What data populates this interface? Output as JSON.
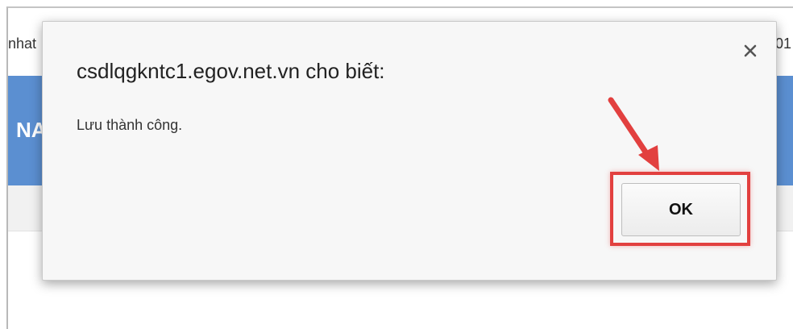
{
  "background": {
    "left_text": "nhat",
    "right_text": "01",
    "blue_bar_text": "NA",
    "blue_color": "#5b8fd1"
  },
  "dialog": {
    "title": "csdlqgkntc1.egov.net.vn cho biết:",
    "message": "Lưu thành công.",
    "close_label": "×",
    "ok_label": "OK",
    "highlight_color": "#e2403f"
  }
}
